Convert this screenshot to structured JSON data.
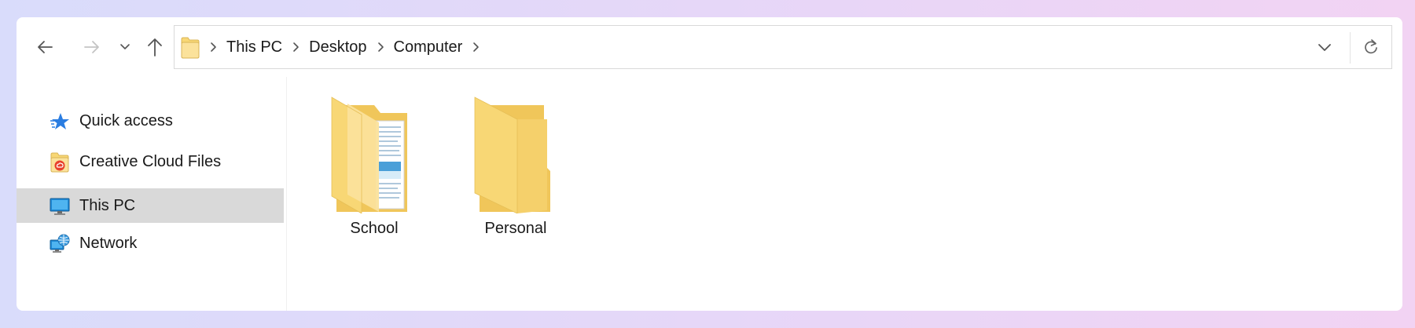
{
  "window": {
    "accent_folder": "#f5d77f",
    "selected_bg": "#d9d9d9"
  },
  "navigation": {
    "back_icon": "arrow-left-icon",
    "forward_icon": "arrow-right-icon",
    "recent_icon": "chevron-down-icon",
    "up_icon": "arrow-up-icon"
  },
  "address_bar": {
    "folder_icon": "folder-icon",
    "breadcrumbs": [
      "This PC",
      "Desktop",
      "Computer"
    ],
    "dropdown_icon": "chevron-down-icon",
    "refresh_icon": "refresh-icon"
  },
  "sidebar": {
    "items": [
      {
        "label": "Quick access",
        "icon": "star-icon",
        "selected": false
      },
      {
        "label": "Creative Cloud Files",
        "icon": "creative-cloud-folder-icon",
        "selected": false
      },
      {
        "label": "This PC",
        "icon": "monitor-icon",
        "selected": true
      },
      {
        "label": "Network",
        "icon": "network-icon",
        "selected": false
      }
    ]
  },
  "content": {
    "folders": [
      {
        "name": "School",
        "icon": "folder-with-documents-icon"
      },
      {
        "name": "Personal",
        "icon": "folder-icon"
      }
    ]
  }
}
